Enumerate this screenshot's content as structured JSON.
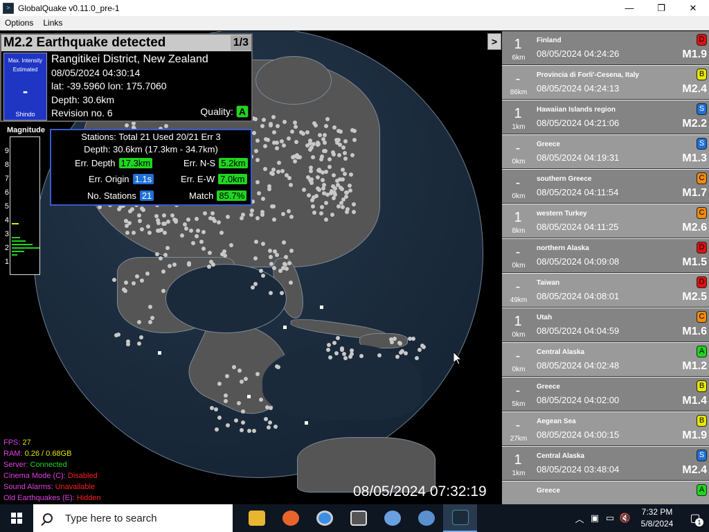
{
  "window": {
    "title": "GlobalQuake v0.11.0_pre-1",
    "minimize": "—",
    "maximize": "❐",
    "close": "✕"
  },
  "menu": {
    "options": "Options",
    "links": "Links"
  },
  "expand_button": ">",
  "quake_panel": {
    "title": "M2.2 Earthquake detected",
    "page": "1/3",
    "intensity_label_1": "Max. Intensity",
    "intensity_label_2": "Estimated",
    "intensity_value": "-",
    "intensity_unit": "Shindo",
    "region": "Rangitikei District, New Zealand",
    "datetime": "08/05/2024 04:30:14",
    "coords": "lat: -39.5960 lon: 175.7060",
    "depth": "Depth: 30.6km",
    "revision": "Revision no. 6",
    "quality_label": "Quality:",
    "quality_value": "A"
  },
  "stations_panel": {
    "line1": "Stations: Total 21 Used 20/21 Err 3",
    "line2": "Depth: 30.6km (17.3km - 34.7km)",
    "err_depth_label": "Err. Depth",
    "err_depth_value": "17.3km",
    "err_ns_label": "Err. N-S",
    "err_ns_value": "5.2km",
    "err_origin_label": "Err. Origin",
    "err_origin_value": "1.1s",
    "err_ew_label": "Err. E-W",
    "err_ew_value": "7.0km",
    "no_stations_label": "No. Stations",
    "no_stations_value": "21",
    "match_label": "Match",
    "match_value": "85.7%"
  },
  "magnitude_scale": {
    "label": "Magnitude",
    "ticks": [
      "9",
      "8",
      "7",
      "6",
      "5",
      "4",
      "3",
      "2",
      "1"
    ]
  },
  "stats": {
    "fps_label": "FPS:",
    "fps_value": "27",
    "ram_label": "RAM:",
    "ram_value": "0.26 / 0.68GB",
    "server_label": "Server:",
    "server_value": "Connected",
    "cinema_label": "Cinema Mode (C):",
    "cinema_value": "Disabled",
    "alarms_label": "Sound Alarms:",
    "alarms_value": "Unavailable",
    "old_label": "Old Earthquakes (E):",
    "old_value": "Hidden"
  },
  "clock": "08/05/2024 07:32:19",
  "quake_list": [
    {
      "intensity": "1",
      "depth": "6km",
      "region": "Finland",
      "time": "08/05/2024 04:24:26",
      "mag": "M1.9",
      "quality": "D"
    },
    {
      "intensity": "-",
      "depth": "86km",
      "region": "Provincia di Forli'-Cesena, Italy",
      "time": "08/05/2024 04:24:13",
      "mag": "M2.4",
      "quality": "B"
    },
    {
      "intensity": "1",
      "depth": "1km",
      "region": "Hawaiian Islands region",
      "time": "08/05/2024 04:21:06",
      "mag": "M2.2",
      "quality": "S"
    },
    {
      "intensity": "-",
      "depth": "0km",
      "region": "Greece",
      "time": "08/05/2024 04:19:31",
      "mag": "M1.3",
      "quality": "S"
    },
    {
      "intensity": "-",
      "depth": "0km",
      "region": "southern Greece",
      "time": "08/05/2024 04:11:54",
      "mag": "M1.7",
      "quality": "C"
    },
    {
      "intensity": "1",
      "depth": "8km",
      "region": "western Turkey",
      "time": "08/05/2024 04:11:25",
      "mag": "M2.6",
      "quality": "C"
    },
    {
      "intensity": "-",
      "depth": "0km",
      "region": "northern Alaska",
      "time": "08/05/2024 04:09:08",
      "mag": "M1.5",
      "quality": "D"
    },
    {
      "intensity": "-",
      "depth": "49km",
      "region": "Taiwan",
      "time": "08/05/2024 04:08:01",
      "mag": "M2.5",
      "quality": "D"
    },
    {
      "intensity": "1",
      "depth": "0km",
      "region": "Utah",
      "time": "08/05/2024 04:04:59",
      "mag": "M1.6",
      "quality": "C"
    },
    {
      "intensity": "-",
      "depth": "0km",
      "region": "Central Alaska",
      "time": "08/05/2024 04:02:48",
      "mag": "M1.2",
      "quality": "A"
    },
    {
      "intensity": "-",
      "depth": "5km",
      "region": "Greece",
      "time": "08/05/2024 04:02:00",
      "mag": "M1.4",
      "quality": "B"
    },
    {
      "intensity": "-",
      "depth": "27km",
      "region": "Aegean Sea",
      "time": "08/05/2024 04:00:15",
      "mag": "M1.9",
      "quality": "B"
    },
    {
      "intensity": "1",
      "depth": "1km",
      "region": "Central Alaska",
      "time": "08/05/2024 03:48:04",
      "mag": "M2.4",
      "quality": "S"
    },
    {
      "intensity": "",
      "depth": "",
      "region": "Greece",
      "time": "",
      "mag": "",
      "quality": "A"
    }
  ],
  "taskbar": {
    "search_placeholder": "Type here to search",
    "apps": [
      "file-explorer",
      "firefox",
      "chrome",
      "app-4",
      "app-5",
      "app-6",
      "globalquake"
    ],
    "time": "7:32 PM",
    "date": "5/8/2024",
    "notification_count": "1"
  },
  "colors": {
    "quality_A": "#1fd61f",
    "quality_B": "#e8e800",
    "quality_C": "#f08a10",
    "quality_D": "#e01010",
    "quality_S": "#1f6fd6",
    "intensity_box": "#1f35c4"
  }
}
